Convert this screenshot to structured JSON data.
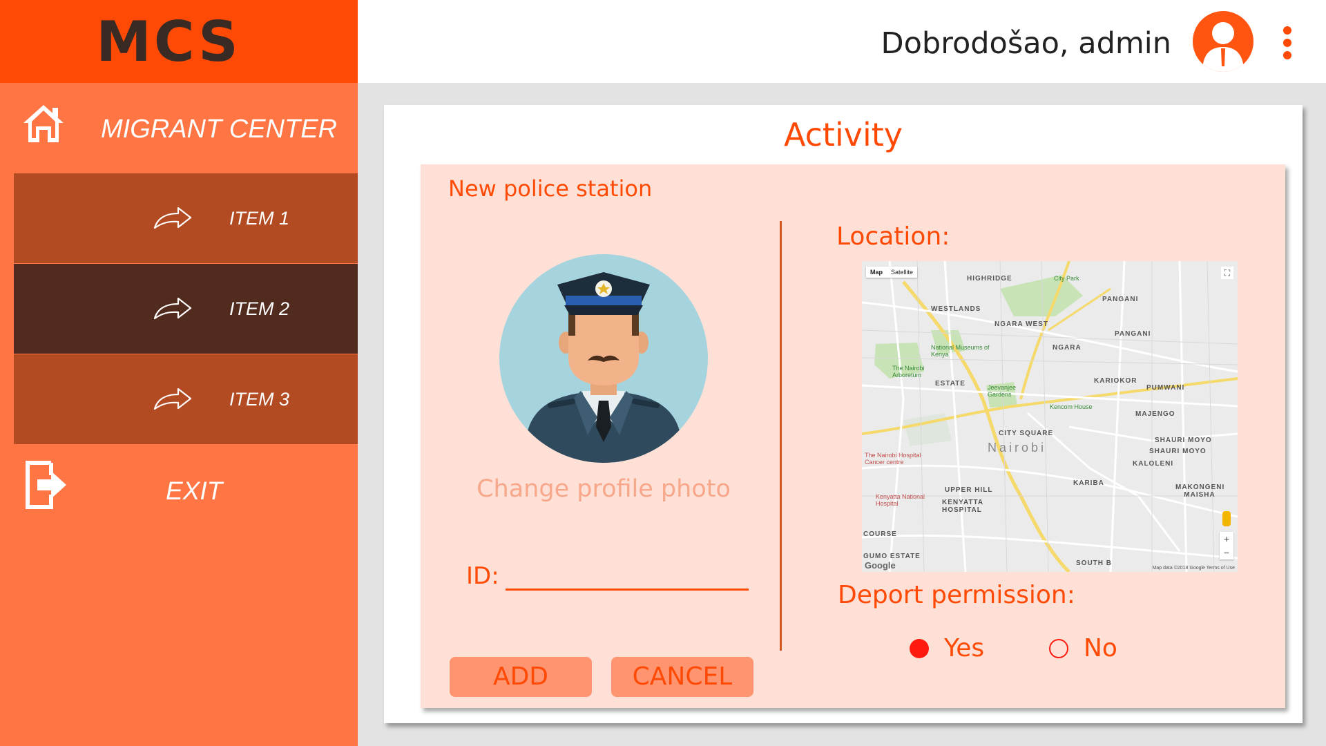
{
  "app": {
    "logo": "MCS"
  },
  "header": {
    "welcome": "Dobrodošao, admin"
  },
  "sidebar": {
    "home_label": "MIGRANT CENTER",
    "items": [
      {
        "label": "ITEM 1"
      },
      {
        "label": "ITEM 2"
      },
      {
        "label": "ITEM 3"
      }
    ],
    "exit_label": "EXIT"
  },
  "main": {
    "title": "Activity",
    "subtitle": "New police station",
    "change_photo": "Change profile photo",
    "id_label": "ID:",
    "id_value": "",
    "buttons": {
      "add": "ADD",
      "cancel": "CANCEL"
    },
    "location_label": "Location:",
    "map": {
      "toggle_map": "Map",
      "toggle_satellite": "Satellite",
      "city": "Nairobi",
      "google": "Google",
      "footer": "Map data ©2018 Google   Terms of Use",
      "places": {
        "highridge": "HIGHRIDGE",
        "city_park": "City Park",
        "westlands": "WESTLANDS",
        "pangani_1": "PANGANI",
        "ngara_west": "NGARA WEST",
        "pangani_2": "PANGANI",
        "museums": "National Museums of Kenya",
        "ngara": "NGARA",
        "arboretum": "The Nairobi Arboretum",
        "kariokor": "KARIOKOR",
        "estate": "ESTATE",
        "jeevanjee": "Jeevanjee Gardens",
        "pumwani": "PUMWANI",
        "kencom": "Kencom House",
        "majengo": "MAJENGO",
        "city_square": "CITY SQUARE",
        "shauri_moyo_1": "SHAURI MOYO",
        "shauri_moyo_2": "SHAURI MOYO",
        "hospital_cancer": "The Nairobi Hospital Cancer centre",
        "kaloleni": "KALOLENI",
        "kariba": "KARIBA",
        "makongeni": "MAKONGENI MAISHA",
        "upper_hill": "UPPER HILL",
        "kenyatta_nh": "Kenyatta National Hospital",
        "kenyatta_hospital": "KENYATTA HOSPITAL",
        "course": "COURSE",
        "gumo_estate": "GUMO ESTATE",
        "south_b": "SOUTH B"
      }
    },
    "deport_label": "Deport permission:",
    "deport_options": {
      "yes": "Yes",
      "no": "No"
    },
    "deport_selected": "yes"
  },
  "colors": {
    "primary": "#ff4a05",
    "sidebar": "#ff7543",
    "nav_item": "#b24a22",
    "nav_active": "#522b1f",
    "panel": "#ffe0d6",
    "button": "#ff9570"
  }
}
